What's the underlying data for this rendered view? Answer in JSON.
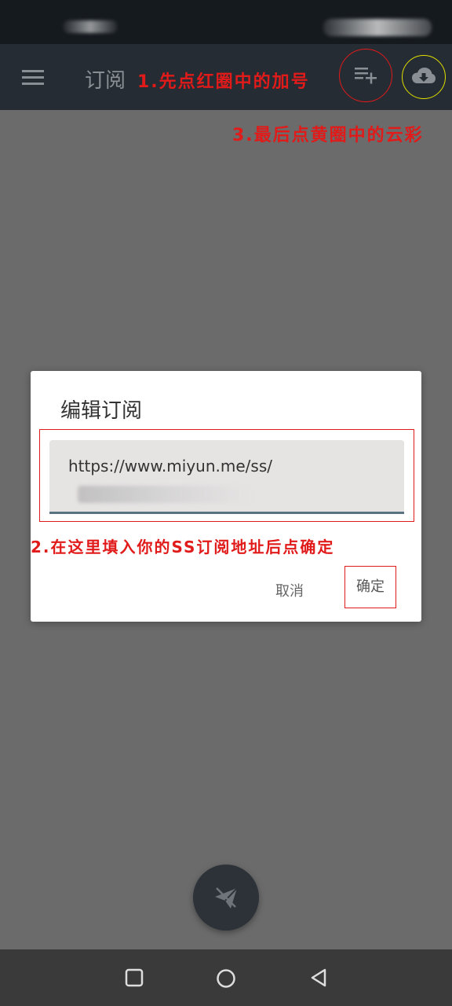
{
  "app_bar": {
    "title": "订阅",
    "menu_icon": "menu-icon",
    "add_icon": "add-to-list-icon",
    "download_icon": "cloud-download-icon"
  },
  "annotations": {
    "step1": "1.先点红圈中的加号",
    "step2": "2.在这里填入你的SS订阅地址后点确定",
    "step3": "3.最后点黄圈中的云彩"
  },
  "dialog": {
    "title": "编辑订阅",
    "input_value": "https://www.miyun.me/ss/",
    "cancel_label": "取消",
    "ok_label": "确定"
  },
  "fab": {
    "icon": "paper-plane-off-icon"
  },
  "nav": {
    "recents_icon": "square-icon",
    "home_icon": "circle-icon",
    "back_icon": "triangle-back-icon"
  },
  "colors": {
    "annotation_red": "#e11a1a",
    "highlight_yellow": "#e0e000",
    "app_bar": "#262c33",
    "scrim": "#6b6b6b"
  }
}
